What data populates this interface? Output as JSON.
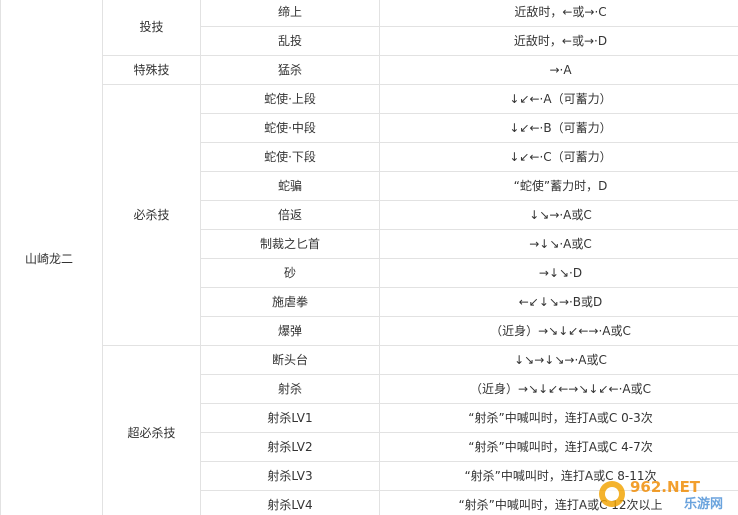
{
  "character": "山崎龙二",
  "categories": [
    {
      "label": "投技",
      "rows": [
        {
          "name": "缔上",
          "command": "近敌时，←或→·C"
        },
        {
          "name": "乱投",
          "command": "近敌时，←或→·D"
        }
      ]
    },
    {
      "label": "特殊技",
      "rows": [
        {
          "name": "猛杀",
          "command": "→·A"
        }
      ]
    },
    {
      "label": "必杀技",
      "rows": [
        {
          "name": "蛇使·上段",
          "command": "↓↙←·A（可蓄力）"
        },
        {
          "name": "蛇使·中段",
          "command": "↓↙←·B（可蓄力）"
        },
        {
          "name": "蛇使·下段",
          "command": "↓↙←·C（可蓄力）"
        },
        {
          "name": "蛇骗",
          "command": "“蛇使”蓄力时，D"
        },
        {
          "name": "倍返",
          "command": "↓↘→·A或C"
        },
        {
          "name": "制裁之匕首",
          "command": "→↓↘·A或C"
        },
        {
          "name": "砂",
          "command": "→↓↘·D"
        },
        {
          "name": "施虐拳",
          "command": "←↙↓↘→·B或D"
        },
        {
          "name": "爆弹",
          "command": "（近身）→↘↓↙←→·A或C"
        }
      ]
    },
    {
      "label": "超必杀技",
      "rows": [
        {
          "name": "断头台",
          "command": "↓↘→↓↘→·A或C"
        },
        {
          "name": "射杀",
          "command": "（近身）→↘↓↙←→↘↓↙←·A或C"
        },
        {
          "name": "射杀LV1",
          "command": "“射杀”中喊叫时，连打A或C 0-3次"
        },
        {
          "name": "射杀LV2",
          "command": "“射杀”中喊叫时，连打A或C 4-7次"
        },
        {
          "name": "射杀LV3",
          "command": "“射杀”中喊叫时，连打A或C 8-11次"
        },
        {
          "name": "射杀LV4",
          "command": "“射杀”中喊叫时，连打A或C 12次以上"
        }
      ]
    }
  ],
  "watermark": {
    "brand": "962.NET",
    "subtitle": "乐游网"
  }
}
